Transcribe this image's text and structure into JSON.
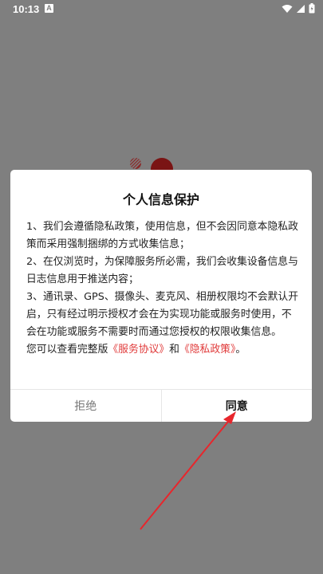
{
  "status_bar": {
    "time": "10:13",
    "notification_icon": "A",
    "icons": [
      "wifi-icon",
      "signal-icon",
      "battery-icon"
    ]
  },
  "dialog": {
    "title": "个人信息保护",
    "paragraphs": [
      "1、我们会遵循隐私政策，使用信息，但不会因同意本隐私政策而采用强制捆绑的方式收集信息；",
      "2、在仅浏览时，为保障服务所必需，我们会收集设备信息与日志信息用于推送内容；",
      "3、通讯录、GPS、摄像头、麦克风、相册权限均不会默认开启，只有经过明示授权才会在为实现功能或服务时使用，不会在功能或服务不需要时而通过您授权的权限收集信息。"
    ],
    "footer_prefix": "您可以查看完整版",
    "service_link": "《服务协议》",
    "footer_and": "和",
    "privacy_link": "《隐私政策》",
    "footer_suffix": "。",
    "reject_label": "拒绝",
    "agree_label": "同意"
  },
  "colors": {
    "link": "#e03a3a",
    "overlay": "#7f7f7f",
    "arrow": "#e8262c"
  }
}
